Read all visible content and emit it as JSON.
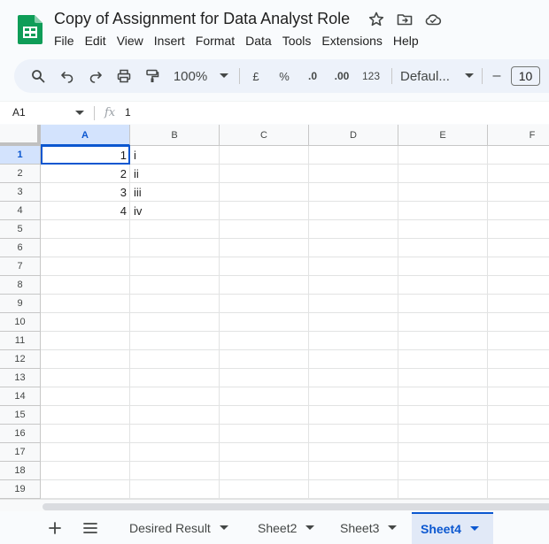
{
  "app": {
    "title": "Copy of Assignment for Data Analyst Role",
    "menu": [
      "File",
      "Edit",
      "View",
      "Insert",
      "Format",
      "Data",
      "Tools",
      "Extensions",
      "Help"
    ]
  },
  "toolbar": {
    "zoom": "100%",
    "currency": "£",
    "percent": "%",
    "decrease_decimal": ".0",
    "increase_decimal": ".00",
    "number_format": "123",
    "font": "Defaul...",
    "font_size": "10",
    "font_size_minus": "–"
  },
  "formula_bar": {
    "name_box": "A1",
    "fx": "fx",
    "value": "1"
  },
  "grid": {
    "columns": [
      "A",
      "B",
      "C",
      "D",
      "E",
      "F"
    ],
    "rows": [
      "1",
      "2",
      "3",
      "4",
      "5",
      "6",
      "7",
      "8",
      "9",
      "10",
      "11",
      "12",
      "13",
      "14",
      "15",
      "16",
      "17",
      "18",
      "19"
    ],
    "selected_cell": "A1",
    "cells": {
      "A1": "1",
      "A2": "2",
      "A3": "3",
      "A4": "4",
      "B1": "i",
      "B2": "ii",
      "B3": "iii",
      "B4": "iv"
    }
  },
  "sheets": {
    "tabs": [
      "Desired Result",
      "Sheet2",
      "Sheet3",
      "Sheet4"
    ],
    "active": "Sheet4"
  },
  "colors": {
    "accent": "#0b57d0",
    "toolbar_bg": "#edf2fa",
    "logo_green": "#0f9d58"
  }
}
